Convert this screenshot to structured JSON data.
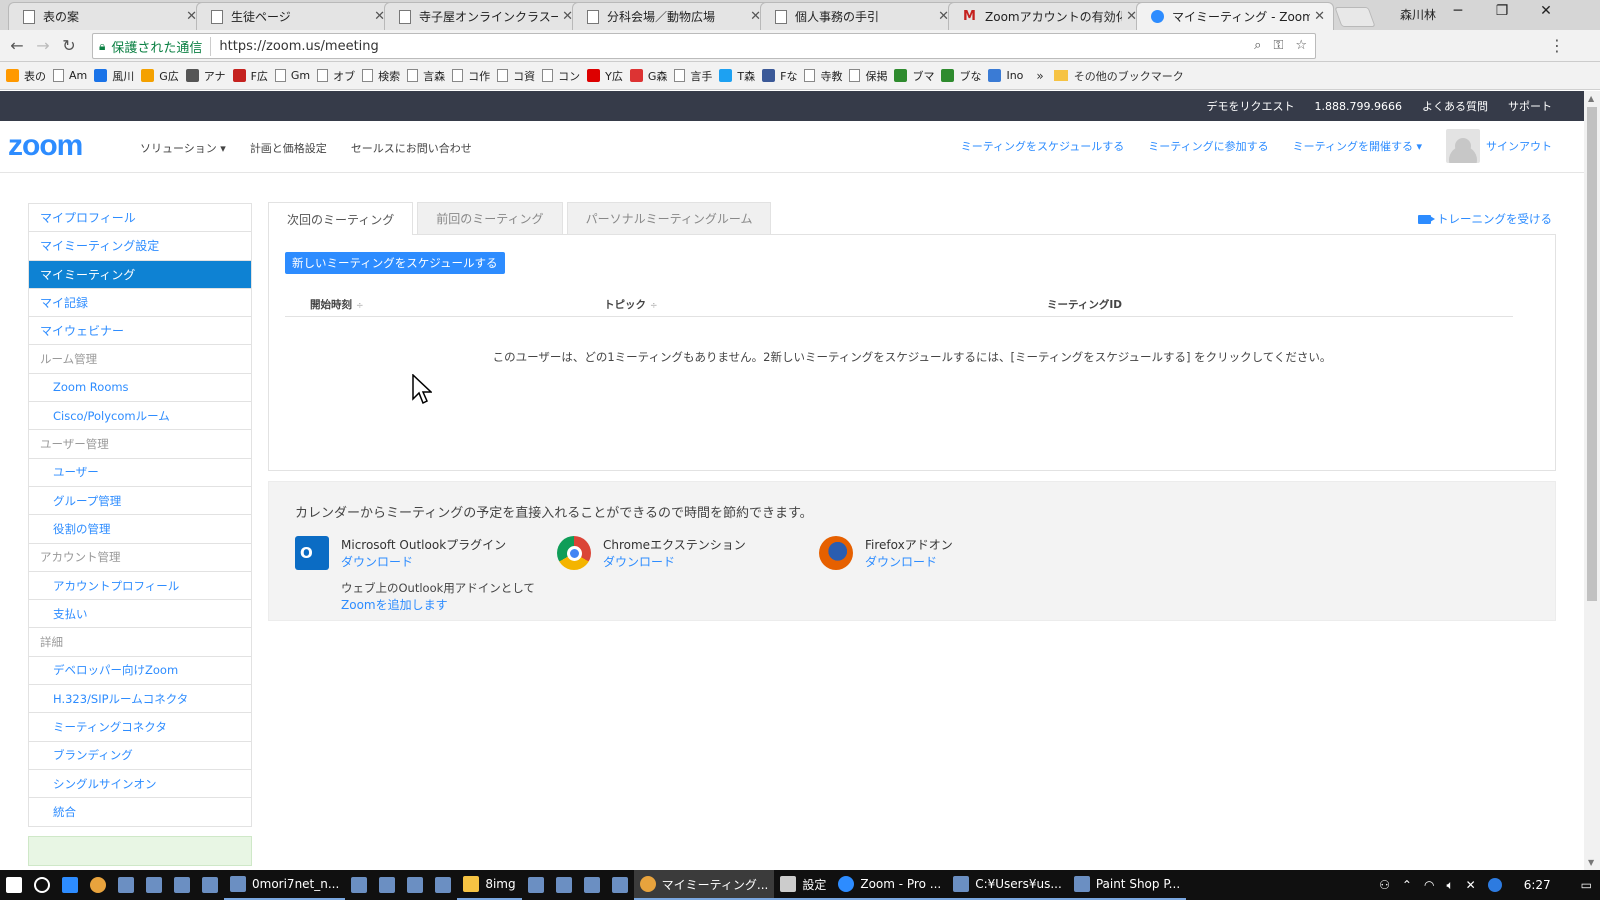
{
  "browser": {
    "tabs": [
      {
        "label": "表の案",
        "icon": "page"
      },
      {
        "label": "生徒ページ",
        "icon": "page"
      },
      {
        "label": "寺子屋オンラインクラス一覧",
        "icon": "page"
      },
      {
        "label": "分科会場／動物広場",
        "icon": "page"
      },
      {
        "label": "個人事務の手引",
        "icon": "page"
      },
      {
        "label": "Zoomアカウントの有効化 -",
        "icon": "gmail"
      },
      {
        "label": "マイミーティング - Zoom",
        "icon": "zoom"
      }
    ],
    "close_glyph": "✕",
    "window_user": "森川林",
    "url_secure_label": "保護された通信",
    "url": "https://zoom.us/meeting",
    "bookmarks": [
      "表の",
      "Am",
      "風川",
      "G広",
      "アナ",
      "F広",
      "Gm",
      "オブ",
      "検索",
      "言森",
      "コ作",
      "コ資",
      "コン",
      "Y広",
      "G森",
      "言手",
      "T森",
      "Fな",
      "寺教",
      "保掲",
      "ブマ",
      "ブな",
      "Ino"
    ],
    "bookmarks_more": "»",
    "other_bookmarks": "その他のブックマーク"
  },
  "zoom": {
    "topbar": {
      "demo": "デモをリクエスト",
      "phone": "1.888.799.9666",
      "faq": "よくある質問",
      "support": "サポート"
    },
    "logo": "zoom",
    "nav_left": [
      "ソリューション ▾",
      "計画と価格設定",
      "セールスにお問い合わせ"
    ],
    "nav_right": {
      "schedule": "ミーティングをスケジュールする",
      "join": "ミーティングに参加する",
      "host": "ミーティングを開催する ▾",
      "signout": "サインアウト"
    },
    "sidebar": [
      {
        "label": "マイプロフィール",
        "type": "item"
      },
      {
        "label": "マイミーティング設定",
        "type": "item"
      },
      {
        "label": "マイミーティング",
        "type": "active"
      },
      {
        "label": "マイ記録",
        "type": "item"
      },
      {
        "label": "マイウェビナー",
        "type": "item"
      },
      {
        "label": "ルーム管理",
        "type": "heading"
      },
      {
        "label": "Zoom Rooms",
        "type": "sub"
      },
      {
        "label": "Cisco/Polycomルーム",
        "type": "sub"
      },
      {
        "label": "ユーザー管理",
        "type": "heading"
      },
      {
        "label": "ユーザー",
        "type": "sub"
      },
      {
        "label": "グループ管理",
        "type": "sub"
      },
      {
        "label": "役割の管理",
        "type": "sub"
      },
      {
        "label": "アカウント管理",
        "type": "heading"
      },
      {
        "label": "アカウントプロフィール",
        "type": "sub"
      },
      {
        "label": "支払い",
        "type": "sub"
      },
      {
        "label": "詳細",
        "type": "heading"
      },
      {
        "label": "デベロッパー向けZoom",
        "type": "sub"
      },
      {
        "label": "H.323/SIPルームコネクタ",
        "type": "sub"
      },
      {
        "label": "ミーティングコネクタ",
        "type": "sub"
      },
      {
        "label": "ブランディング",
        "type": "sub"
      },
      {
        "label": "シングルサインオン",
        "type": "sub"
      },
      {
        "label": "統合",
        "type": "sub"
      }
    ],
    "tabs": [
      "次回のミーティング",
      "前回のミーティング",
      "パーソナルミーティングルーム"
    ],
    "training": "トレーニングを受ける",
    "schedule_button": "新しいミーティングをスケジュールする",
    "table_headers": {
      "start": "開始時刻",
      "topic": "トピック",
      "meeting_id": "ミーティングID"
    },
    "sort_glyph": "÷",
    "empty_message": "このユーザーは、どの1ミーティングもありません。2新しいミーティングをスケジュールするには、[ミーティングをスケジュールする] をクリックしてください。",
    "promo": {
      "title": "カレンダーからミーティングの予定を直接入れることができるので時間を節約できます。",
      "outlook_name": "Microsoft Outlookプラグイン",
      "outlook_icon_text": "O",
      "outlook_link": "ダウンロード",
      "outlook_note": "ウェブ上のOutlook用アドインとして",
      "outlook_note_link": "Zoomを追加します",
      "chrome_name": "Chromeエクステンション",
      "chrome_link": "ダウンロード",
      "firefox_name": "Firefoxアドオン",
      "firefox_link": "ダウンロード"
    }
  },
  "taskbar": {
    "items": [
      {
        "label": "",
        "icon": "windows-start-icon"
      },
      {
        "label": "",
        "icon": "cortana-icon"
      },
      {
        "label": "",
        "icon": "edge-icon"
      },
      {
        "label": "",
        "icon": "chrome-icon"
      },
      {
        "label": "",
        "icon": "app-icon"
      },
      {
        "label": "",
        "icon": "app-icon"
      },
      {
        "label": "",
        "icon": "app-icon"
      },
      {
        "label": "",
        "icon": "app-icon"
      },
      {
        "label": "0mori7net_n...",
        "icon": "app-icon"
      },
      {
        "label": "",
        "icon": "app-icon"
      },
      {
        "label": "",
        "icon": "app-icon"
      },
      {
        "label": "",
        "icon": "app-icon"
      },
      {
        "label": "",
        "icon": "app-icon"
      },
      {
        "label": "8img",
        "icon": "folder-icon"
      },
      {
        "label": "",
        "icon": "app-icon"
      },
      {
        "label": "",
        "icon": "app-icon"
      },
      {
        "label": "",
        "icon": "app-icon"
      },
      {
        "label": "",
        "icon": "app-icon"
      },
      {
        "label": "マイミーティング...",
        "icon": "chrome-icon",
        "active": true
      },
      {
        "label": "設定",
        "icon": "gear-icon"
      },
      {
        "label": "Zoom - Pro ...",
        "icon": "zoom-icon"
      },
      {
        "label": "C:¥Users¥us...",
        "icon": "app-icon"
      },
      {
        "label": "Paint Shop P...",
        "icon": "app-icon"
      }
    ],
    "clock": "6:27"
  },
  "colors": {
    "zoom_blue": "#2d8cff",
    "sidebar_active": "#0e82d3",
    "topbar": "#363b49"
  }
}
